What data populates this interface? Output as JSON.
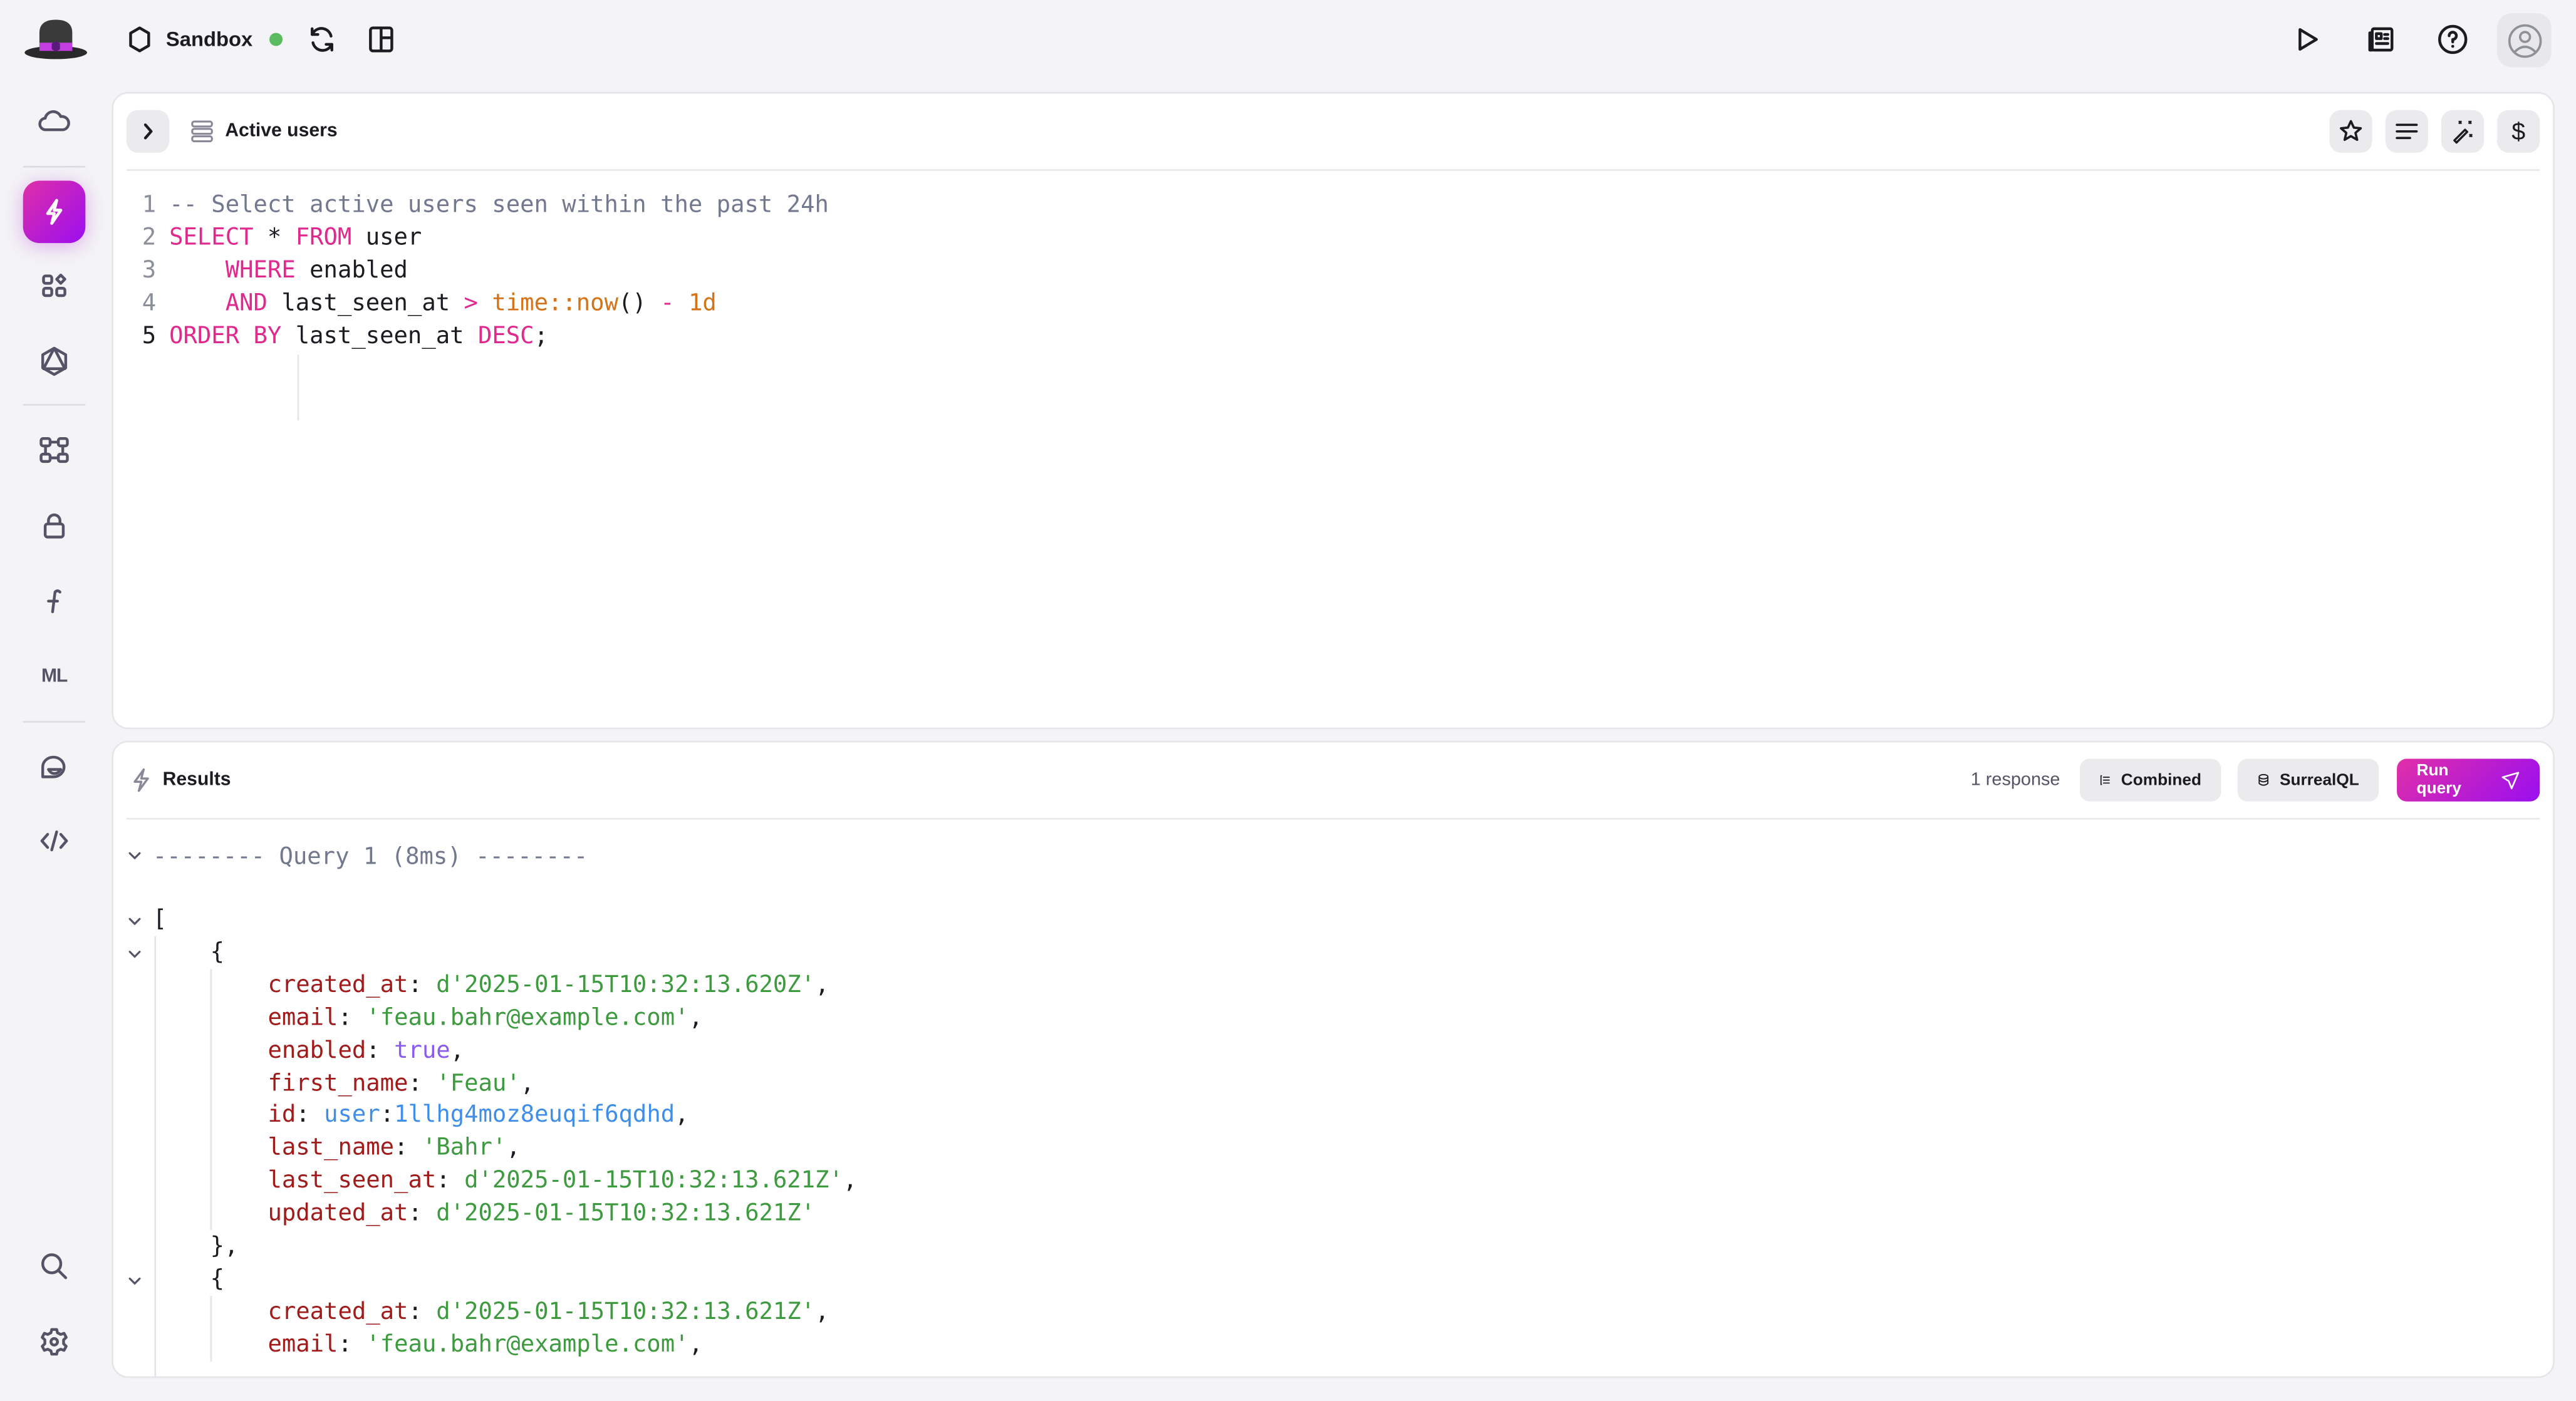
{
  "header": {
    "environment": "Sandbox",
    "environment_status": "connected"
  },
  "sidebar": {
    "items": [
      {
        "name": "cloud",
        "icon": "cloud-icon"
      },
      {
        "name": "query",
        "icon": "lightning-icon",
        "active": true
      },
      {
        "name": "explorer",
        "icon": "grid-icon"
      },
      {
        "name": "graphql",
        "icon": "graphql-icon"
      },
      {
        "name": "designer",
        "icon": "schema-icon"
      },
      {
        "name": "authentication",
        "icon": "lock-icon"
      },
      {
        "name": "functions",
        "icon": "function-icon",
        "label": "ƒ"
      },
      {
        "name": "models",
        "icon": "ml-icon",
        "label": "ML"
      },
      {
        "name": "sidekick",
        "icon": "chat-icon"
      },
      {
        "name": "api-docs",
        "icon": "code-icon"
      }
    ],
    "bottom": [
      {
        "name": "search",
        "icon": "search-icon"
      },
      {
        "name": "settings",
        "icon": "gear-icon"
      }
    ]
  },
  "editor": {
    "title": "Active users",
    "lines": [
      {
        "n": "1",
        "tokens": [
          {
            "t": "-- Select active users seen within the past 24h",
            "c": "cm"
          }
        ]
      },
      {
        "n": "2",
        "tokens": [
          {
            "t": "SELECT",
            "c": "kw"
          },
          {
            "t": " * ",
            "c": "punc"
          },
          {
            "t": "FROM",
            "c": "kw"
          },
          {
            "t": " user",
            "c": "punc"
          }
        ]
      },
      {
        "n": "3",
        "tokens": [
          {
            "t": "    ",
            "c": "punc"
          },
          {
            "t": "WHERE",
            "c": "kw"
          },
          {
            "t": " enabled",
            "c": "punc"
          }
        ]
      },
      {
        "n": "4",
        "tokens": [
          {
            "t": "    ",
            "c": "punc"
          },
          {
            "t": "AND",
            "c": "kw"
          },
          {
            "t": " last_seen_at ",
            "c": "punc"
          },
          {
            "t": ">",
            "c": "op"
          },
          {
            "t": " ",
            "c": "punc"
          },
          {
            "t": "time::now",
            "c": "fn"
          },
          {
            "t": "() ",
            "c": "punc"
          },
          {
            "t": "-",
            "c": "op"
          },
          {
            "t": " ",
            "c": "punc"
          },
          {
            "t": "1d",
            "c": "num"
          }
        ]
      },
      {
        "n": "5",
        "tokens": [
          {
            "t": "ORDER BY",
            "c": "kw"
          },
          {
            "t": " last_seen_at ",
            "c": "punc"
          },
          {
            "t": "DESC",
            "c": "kw"
          },
          {
            "t": ";",
            "c": "punc"
          }
        ]
      }
    ],
    "current_line": "5"
  },
  "results": {
    "title": "Results",
    "response_count": "1 response",
    "mode_button": "Combined",
    "format_button": "SurrealQL",
    "run_button": "Run query",
    "query_header": "-------- Query 1 (8ms) --------",
    "records": [
      {
        "created_at": "d'2025-01-15T10:32:13.620Z'",
        "email": "'feau.bahr@example.com'",
        "enabled": "true",
        "first_name": "'Feau'",
        "id_table": "user",
        "id_key": "1llhg4moz8euqif6qdhd",
        "last_name": "'Bahr'",
        "last_seen_at": "d'2025-01-15T10:32:13.621Z'",
        "updated_at": "d'2025-01-15T10:32:13.621Z'"
      },
      {
        "created_at": "d'2025-01-15T10:32:13.621Z'",
        "email": "'feau.bahr@example.com'"
      }
    ]
  },
  "colors": {
    "accent_start": "#e02fa8",
    "accent_end": "#9a0ef0",
    "status_connected": "#5bbb5f"
  }
}
